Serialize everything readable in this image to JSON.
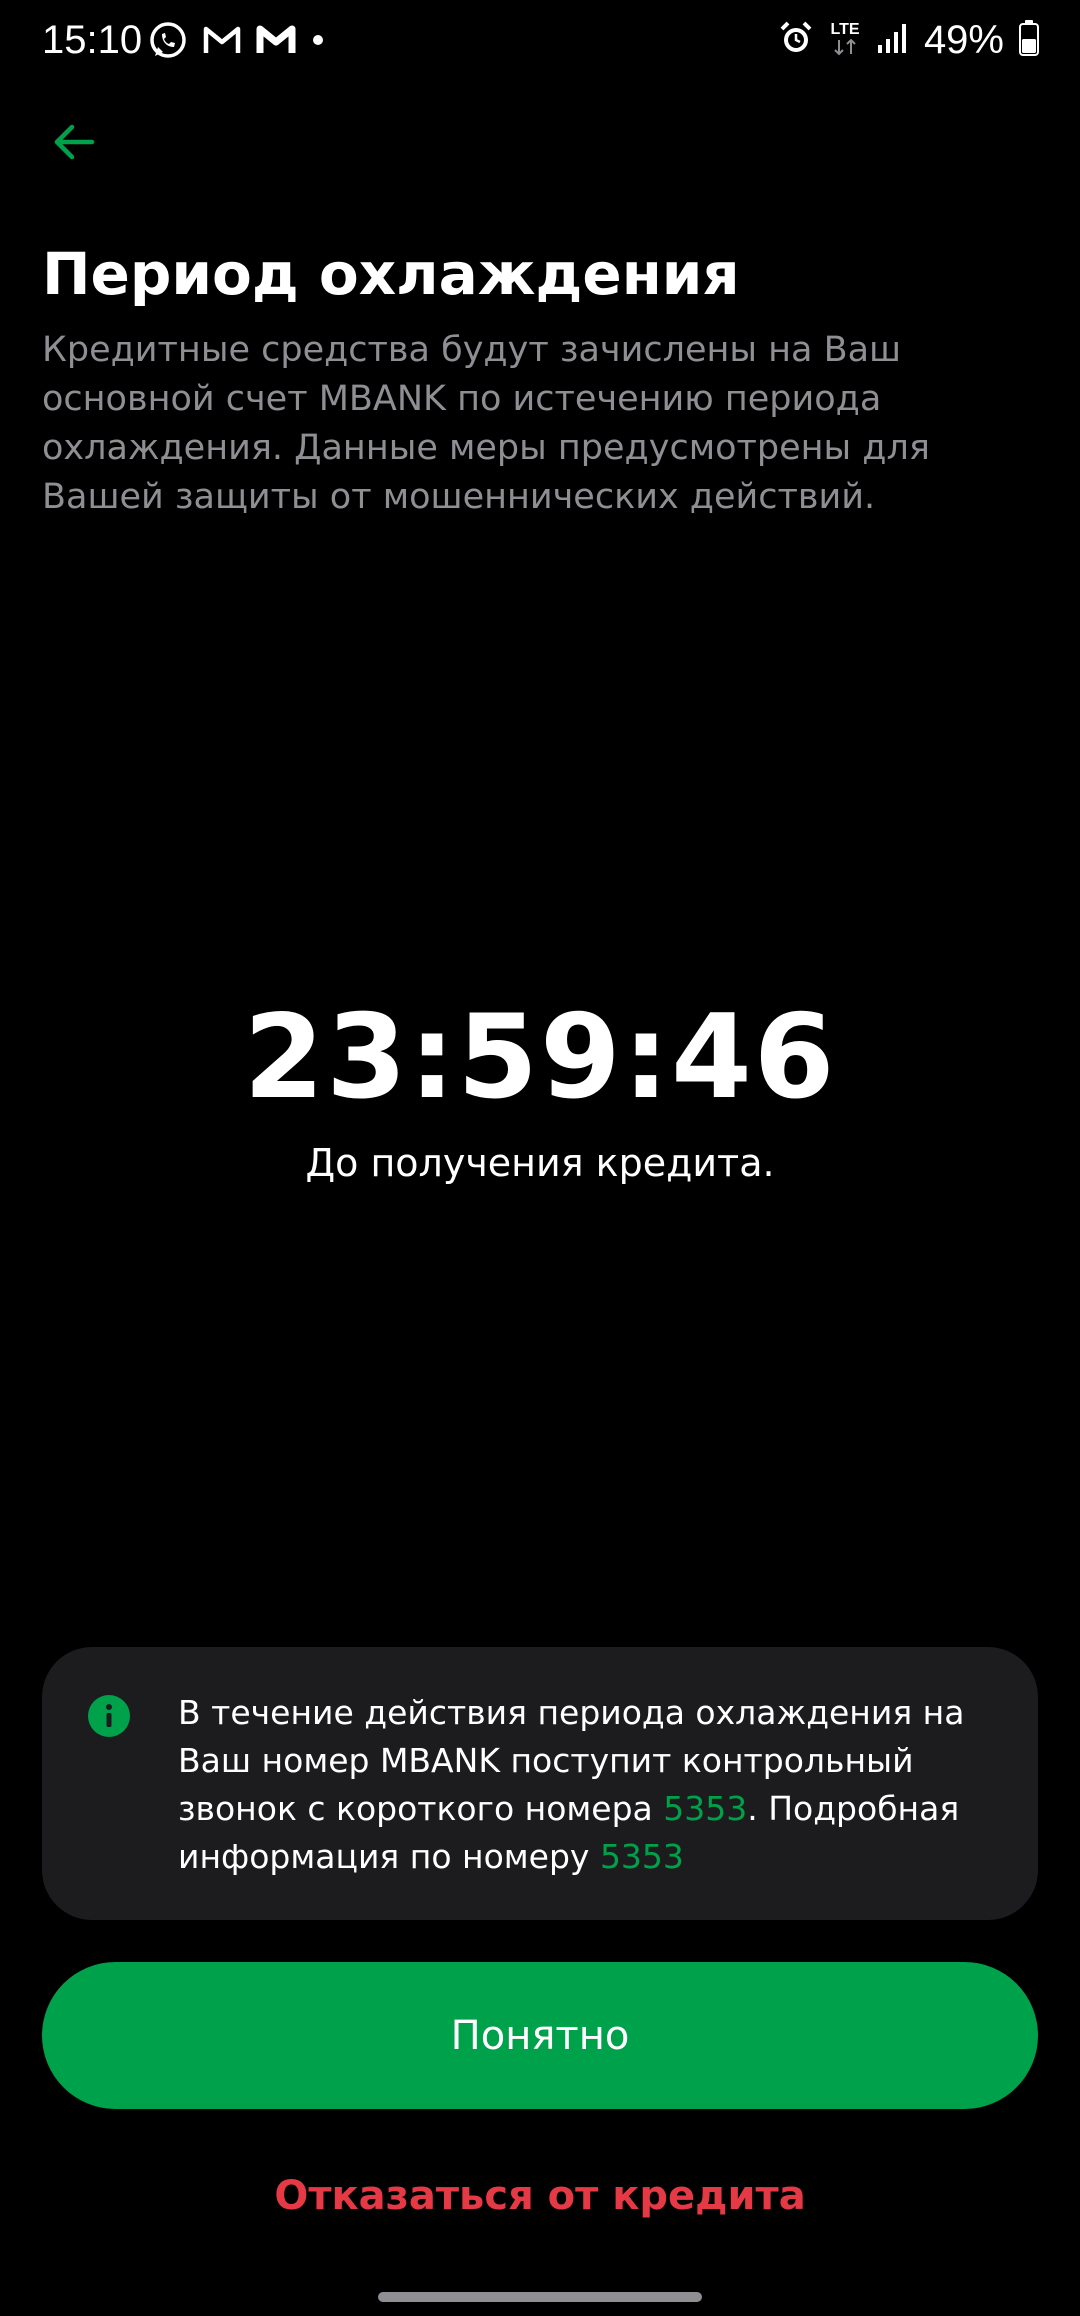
{
  "status_bar": {
    "time": "15:10",
    "battery_percent": "49%",
    "network": "LTE",
    "left_icons": [
      "whatsapp-icon",
      "gmail-icon",
      "gmail-icon",
      "notification-dot-icon"
    ],
    "right_icons": [
      "alarm-icon",
      "lte-icon",
      "signal-icon",
      "battery-icon"
    ]
  },
  "header": {
    "back_icon": "arrow-left-icon",
    "title": "Период охлаждения",
    "description": "Кредитные средства будут зачислены на Ваш основной счет MBANK по истечению периода охлаждения. Данные меры предусмотрены для Вашей защиты от мошеннических действий."
  },
  "countdown": {
    "time": "23:59:46",
    "caption": "До получения кредита."
  },
  "info_card": {
    "icon": "info-icon",
    "text_part1": "В течение действия периода охлаждения на Ваш номер MBANK поступит контрольный звонок с короткого номера ",
    "phone_number_1": "5353",
    "text_part2": ". Подробная информация по номеру ",
    "phone_number_2": "5353"
  },
  "actions": {
    "confirm_label": "Понятно",
    "decline_label": "Отказаться от кредита"
  },
  "colors": {
    "background": "#000000",
    "accent_green": "#00a14b",
    "card_background": "#1c1c1e",
    "decline_red": "#e63946",
    "secondary_text": "#8e8e93"
  }
}
